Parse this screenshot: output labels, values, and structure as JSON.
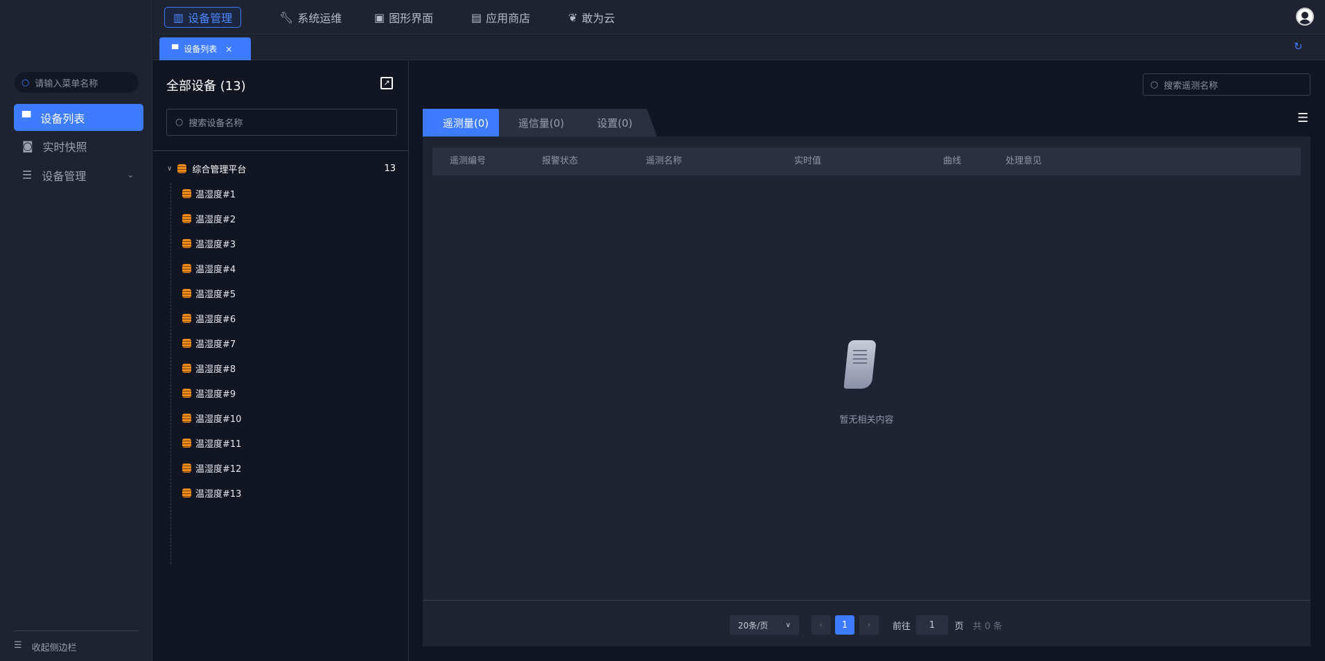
{
  "topnav": {
    "items": [
      {
        "label": "设备管理",
        "icon": "columns-icon"
      },
      {
        "label": "系统运维",
        "icon": "wrench-icon"
      },
      {
        "label": "图形界面",
        "icon": "monitor-icon"
      },
      {
        "label": "应用商店",
        "icon": "store-icon"
      },
      {
        "label": "敢为云",
        "icon": "leaf-icon"
      }
    ]
  },
  "tabbar": {
    "tab_label": "设备列表",
    "close": "×",
    "refresh": "↻"
  },
  "sidebar": {
    "search_placeholder": "请输入菜单名称",
    "items": [
      {
        "label": "设备列表"
      },
      {
        "label": "实时快照"
      },
      {
        "label": "设备管理"
      }
    ],
    "collapse": "收起侧边栏"
  },
  "leftpanel": {
    "title": "全部设备 (13)",
    "search_placeholder": "搜索设备名称",
    "root": {
      "label": "综合管理平台",
      "count": "13"
    },
    "children": [
      "温湿度#1",
      "温湿度#2",
      "温湿度#3",
      "温湿度#4",
      "温湿度#5",
      "温湿度#6",
      "温湿度#7",
      "温湿度#8",
      "温湿度#9",
      "温湿度#10",
      "温湿度#11",
      "温湿度#12",
      "温湿度#13"
    ]
  },
  "content": {
    "search_placeholder": "搜索遥测名称",
    "tabs": [
      "遥测量(0)",
      "遥信量(0)",
      "设置(0)"
    ],
    "columns": [
      "遥测编号",
      "报警状态",
      "遥测名称",
      "实时值",
      "曲线",
      "处理意见"
    ],
    "empty": "暂无相关内容"
  },
  "pagination": {
    "page_size": "20条/页",
    "current": "1",
    "goto": "前往",
    "goto_value": "1",
    "page_unit": "页",
    "total": "共 0 条"
  }
}
